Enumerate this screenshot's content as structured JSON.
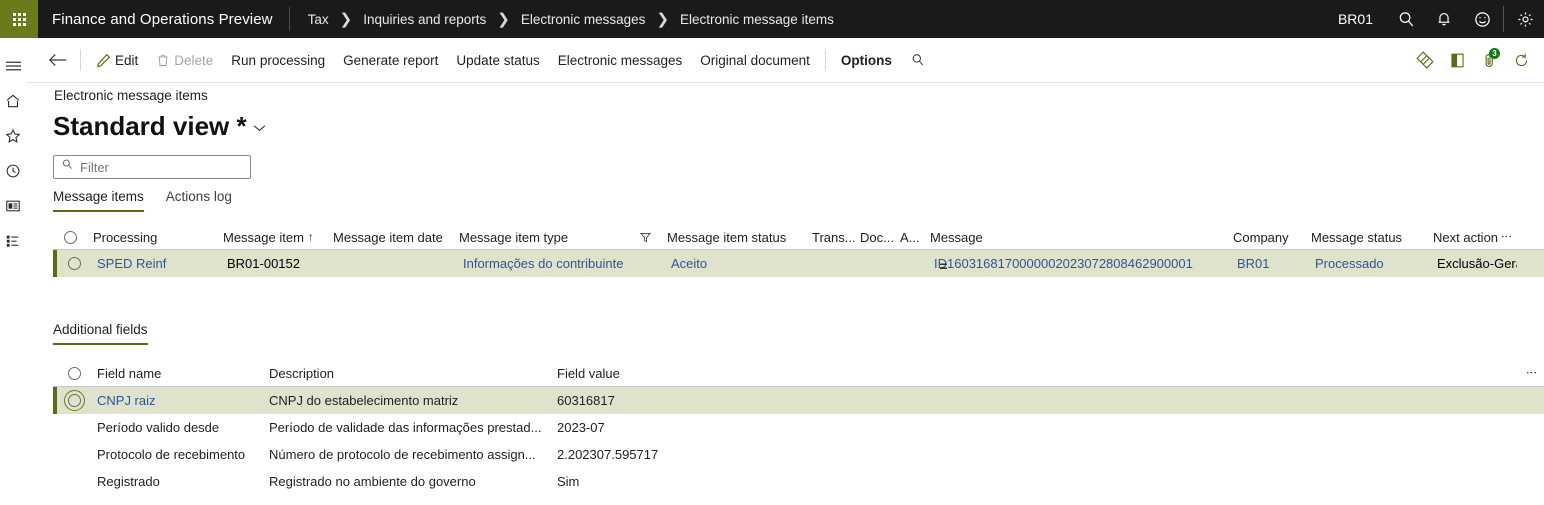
{
  "topbar": {
    "app_title": "Finance and Operations Preview",
    "breadcrumb": [
      "Tax",
      "Inquiries and reports",
      "Electronic messages",
      "Electronic message items"
    ],
    "company_code": "BR01",
    "icons": [
      "search-icon",
      "notifications-bell-icon",
      "feedback-smiley-icon",
      "settings-gear-icon"
    ],
    "waffle_icon": "app-launcher-waffle-icon"
  },
  "rail": {
    "icons": [
      "hamburger-menu-icon",
      "home-icon",
      "favorites-star-icon",
      "recent-clock-icon",
      "workspaces-icon",
      "modules-list-icon"
    ]
  },
  "actionpane": {
    "back_icon": "back-arrow-icon",
    "buttons": [
      {
        "label": "Edit",
        "icon": "pencil-icon",
        "disabled": false,
        "bold": false
      },
      {
        "label": "Delete",
        "icon": "trash-icon",
        "disabled": true,
        "bold": false
      },
      {
        "label": "Run processing",
        "icon": "",
        "disabled": false,
        "bold": false
      },
      {
        "label": "Generate report",
        "icon": "",
        "disabled": false,
        "bold": false
      },
      {
        "label": "Update status",
        "icon": "",
        "disabled": false,
        "bold": false
      },
      {
        "label": "Electronic messages",
        "icon": "",
        "disabled": false,
        "bold": false
      },
      {
        "label": "Original document",
        "icon": "",
        "disabled": false,
        "bold": false
      },
      {
        "label": "Options",
        "icon": "",
        "disabled": false,
        "bold": true
      }
    ],
    "search_icon": "search-icon",
    "right_icons": [
      "personalize-diamond-icon",
      "open-in-office-icon",
      "attachments-icon",
      "refresh-icon"
    ],
    "attachment_badge": "3"
  },
  "page": {
    "caption": "Electronic message items",
    "view_title": "Standard view *",
    "view_caret": "⌄"
  },
  "filter": {
    "placeholder": "Filter",
    "value": "",
    "icon": "search-icon"
  },
  "tabs": [
    {
      "label": "Message items",
      "active": true
    },
    {
      "label": "Actions log",
      "active": false
    }
  ],
  "message_grid": {
    "columns": [
      "Processing",
      "Message item",
      "Message item date",
      "Message item type",
      "Message item status",
      "Trans...",
      "Doc...",
      "A...",
      "Message",
      "Company",
      "Message status",
      "Next action"
    ],
    "sort_indicator_column": "Message item",
    "sort_indicator": "↑",
    "filter_indicator_column": "Message item status",
    "rows": [
      {
        "processing": "SPED Reinf",
        "message_item": "BR01-00152",
        "message_item_date": "",
        "message_item_type": "Informações do contribuinte",
        "message_item_status": "Aceito",
        "trans": "",
        "doc": "",
        "a": "",
        "message": "ID1603168170000002023072808462900001",
        "company": "BR01",
        "message_status": "Processado",
        "next_action": "Exclusão-Gera"
      }
    ]
  },
  "splitter": {
    "handle": "="
  },
  "additional_fields": {
    "tab_label": "Additional fields",
    "columns": [
      "Field name",
      "Description",
      "Field value"
    ],
    "rows": [
      {
        "field_name": "CNPJ raiz",
        "description": "CNPJ do estabelecimento matriz",
        "field_value": "60316817",
        "selected": true
      },
      {
        "field_name": "Período valido desde",
        "description": "Período de validade das informações prestad...",
        "field_value": "2023-07",
        "selected": false
      },
      {
        "field_name": "Protocolo de recebimento",
        "description": "Número de protocolo de recebimento assign...",
        "field_value": "2.202307.595717",
        "selected": false
      },
      {
        "field_name": "Registrado",
        "description": "Registrado no ambiente do governo",
        "field_value": "Sim",
        "selected": false
      }
    ]
  },
  "colors": {
    "brand_green": "#6b7a1b",
    "accent_green": "#5d6b17",
    "selected_row_bg": "#dfe3cc",
    "link_blue": "#2b5797",
    "topbar_bg": "#1a1a1a"
  }
}
